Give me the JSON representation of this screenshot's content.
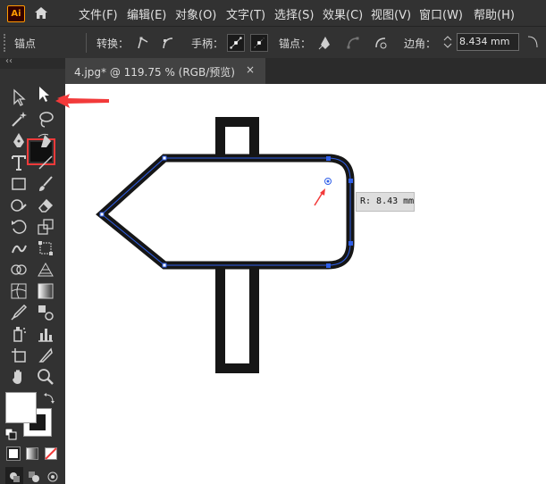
{
  "app": {
    "logo_text": "Ai"
  },
  "menu": {
    "items": [
      "文件(F)",
      "编辑(E)",
      "对象(O)",
      "文字(T)",
      "选择(S)",
      "效果(C)",
      "视图(V)",
      "窗口(W)",
      "帮助(H)"
    ]
  },
  "control_bar": {
    "context_label": "锚点",
    "convert_label": "转换：",
    "handles_label": "手柄：",
    "anchors_label": "锚点：",
    "corner_label": "边角：",
    "corner_value": "8.434 mm"
  },
  "document": {
    "tab_title": "4.jpg* @ 119.75 % (RGB/预览)",
    "close_glyph": "×"
  },
  "canvas": {
    "tooltip_text": "R: 8.43 mm"
  },
  "toolbar": {
    "collapse_glyph": "‹‹",
    "selected_tool": "direct-selection-tool",
    "tools": [
      "selection",
      "direct-selection",
      "magic-wand",
      "lasso",
      "pen",
      "curvature",
      "type",
      "line-segment",
      "rectangle",
      "paintbrush",
      "shaper",
      "eraser",
      "rotate",
      "scale",
      "warp",
      "free-transform",
      "shape-builder",
      "perspective-grid",
      "mesh",
      "gradient",
      "eyedropper",
      "blend",
      "symbol-sprayer",
      "column-graph",
      "artboard",
      "slice",
      "hand",
      "zoom"
    ]
  },
  "colors": {
    "accent_red": "#f23a3a",
    "path_blue": "#2f5fe8",
    "sign_stroke": "#161616"
  }
}
